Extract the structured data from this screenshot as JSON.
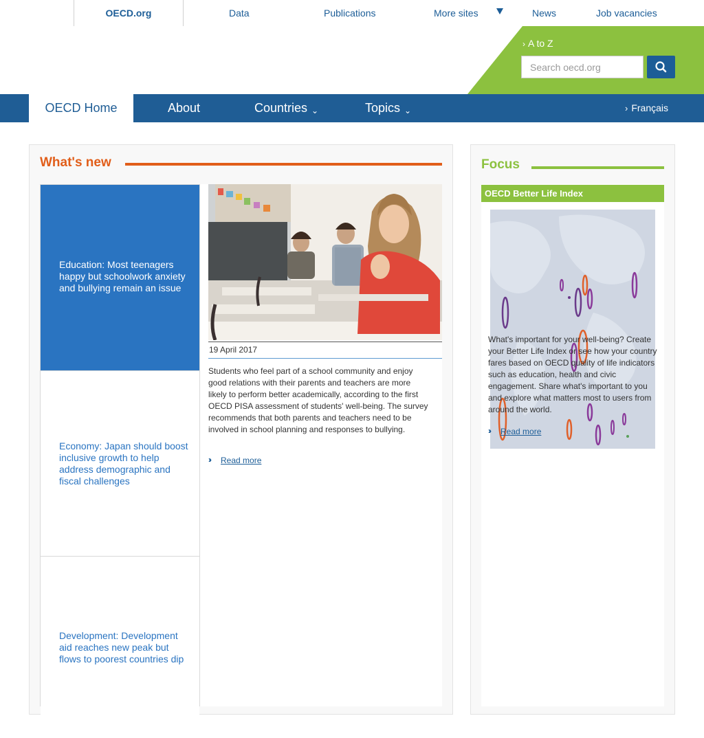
{
  "topbar": {
    "active": "OECD.org",
    "links": [
      "Data",
      "Publications",
      "More sites",
      "News",
      "Job vacancies"
    ]
  },
  "header": {
    "atoz": "A to Z",
    "search_placeholder": "Search oecd.org"
  },
  "mainnav": {
    "home": "OECD Home",
    "about": "About",
    "countries": "Countries",
    "topics": "Topics",
    "language": "Français"
  },
  "whatsnew": {
    "title": "What's new",
    "stories": [
      "Education: Most teenagers happy but schoolwork anxiety and bullying remain an issue",
      "Economy: Japan should boost inclusive growth to help address demographic and fiscal challenges",
      "Development: Development aid reaches new peak but flows to poorest countries dip"
    ],
    "date": "19 April 2017",
    "summary": "Students who feel part of a school community and enjoy good relations with their parents and teachers are more likely to perform better academically, according to the first OECD PISA assessment of students' well-being. The survey recommends that both parents and teachers need to be involved in school planning and responses to bullying.",
    "read_more": "Read more"
  },
  "focus": {
    "title": "Focus",
    "bli_title": "OECD Better Life Index",
    "text": "What's important for your well-being? Create your Better Life Index or see how your country fares based on OECD quality of life indicators such as education, health and civic engagement. Share what's important to you and explore what matters most to users from around the world.",
    "read_more": "Read more"
  },
  "colors": {
    "brand_blue": "#1f5d95",
    "link_blue": "#2a74c1",
    "orange": "#e15e1a",
    "green": "#8cc13f"
  }
}
